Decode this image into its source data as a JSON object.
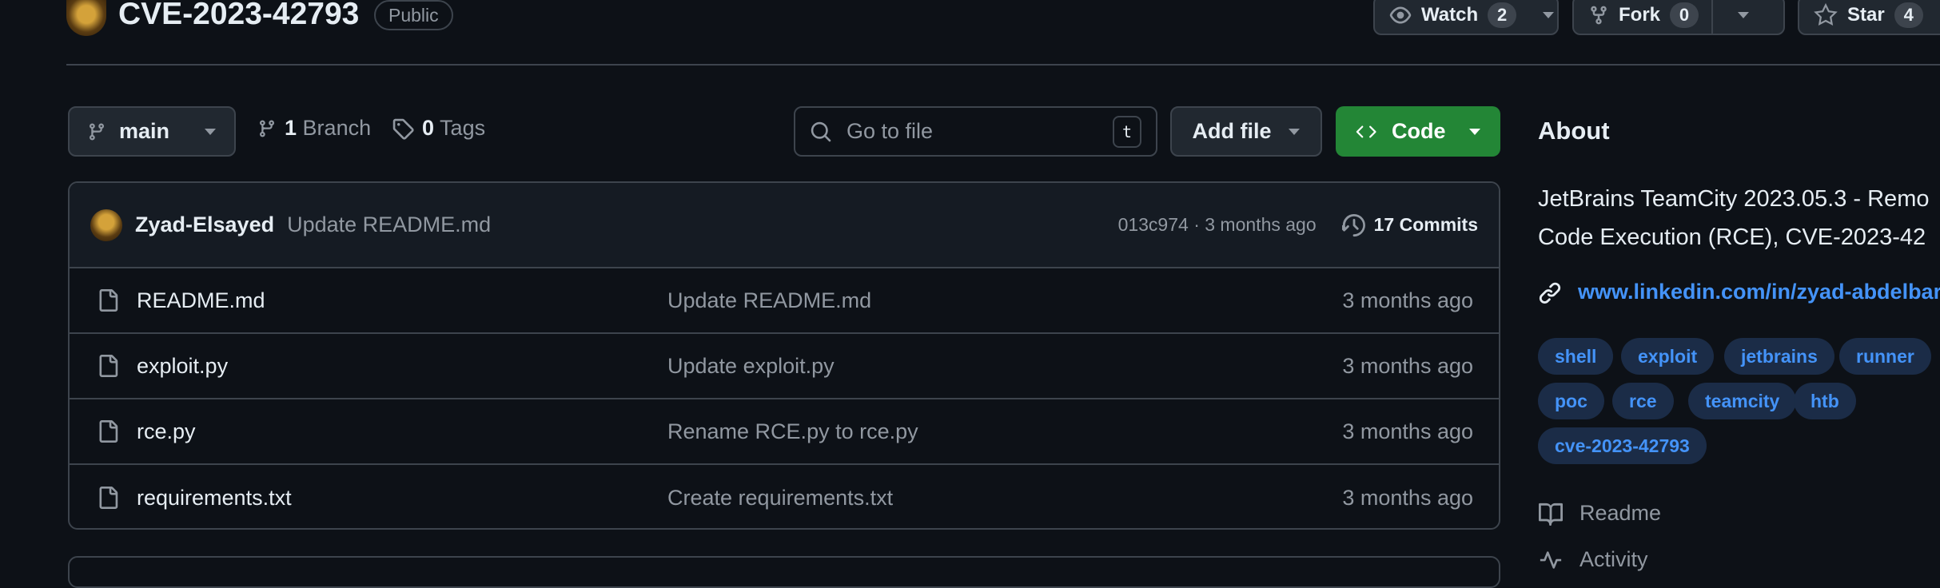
{
  "repo": {
    "name": "CVE-2023-42793",
    "visibility": "Public",
    "watch": {
      "label": "Watch",
      "count": "2"
    },
    "fork": {
      "label": "Fork",
      "count": "0"
    },
    "star": {
      "label": "Star",
      "count": "4"
    }
  },
  "toolbar": {
    "branch": "main",
    "branch_count": "1",
    "branch_label": "Branch",
    "tag_count": "0",
    "tag_label": "Tags",
    "search_placeholder": "Go to file",
    "search_shortcut": "t",
    "add_file": "Add file",
    "code": "Code"
  },
  "latest_commit": {
    "author": "Zyad-Elsayed",
    "message": "Update README.md",
    "meta": "013c974 · 3 months ago",
    "commits": "17 Commits"
  },
  "files": [
    {
      "name": "README.md",
      "commit": "Update README.md",
      "date": "3 months ago"
    },
    {
      "name": "exploit.py",
      "commit": "Update exploit.py",
      "date": "3 months ago"
    },
    {
      "name": "rce.py",
      "commit": "Rename RCE.py to rce.py",
      "date": "3 months ago"
    },
    {
      "name": "requirements.txt",
      "commit": "Create requirements.txt",
      "date": "3 months ago"
    }
  ],
  "about": {
    "heading": "About",
    "description_line1": "JetBrains TeamCity 2023.05.3 - Remo",
    "description_line2": "Code Execution (RCE), CVE-2023-42",
    "link": "www.linkedin.com/in/zyad-abdelbar",
    "topics": [
      "shell",
      "exploit",
      "jetbrains",
      "runner",
      "poc",
      "rce",
      "teamcity",
      "htb",
      "cve-2023-42793"
    ],
    "readme": "Readme",
    "activity": "Activity"
  },
  "colors": {
    "background": "#0d1117",
    "border": "#3d444d",
    "accent_link": "#4493f8",
    "code_button": "#238636"
  }
}
